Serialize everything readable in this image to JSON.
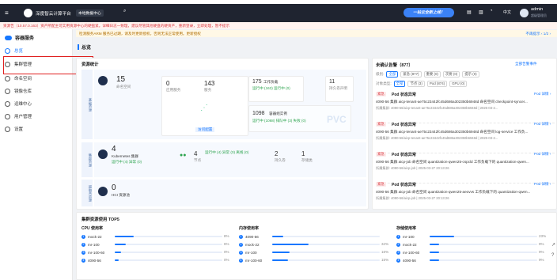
{
  "header": {
    "app_title": "深度智云计算平台",
    "region": "本地数据中心",
    "promo": "一站云全新上线！",
    "lang": "中文",
    "user": "admin",
    "user_sub": "超级管理员"
  },
  "warnings": {
    "line1": "资源告（10.57.0.163）资产所配主可实用资源中心的硬盘紧。详细日志一致理，建议尽管其他硬盘的硬资产，重新登录，立即处理，暂不提示",
    "line2": "检测服务ARM 服务已过期，请及时更新授权，否则无法正常使用。更新授权",
    "pager": "不再提示 ‹ 1/2 ›"
  },
  "sidebar": {
    "title": "容器服务",
    "items": [
      {
        "label": "总览"
      },
      {
        "label": "集群管理"
      },
      {
        "label": "命名空间"
      },
      {
        "label": "镜像仓库"
      },
      {
        "label": "运维中心"
      },
      {
        "label": "用户管理"
      },
      {
        "label": "设置"
      }
    ]
  },
  "page": {
    "title": "总览"
  },
  "resource": {
    "title": "资源统计",
    "namespace_count": "15",
    "namespace_label": "命名空间",
    "apps_count": "0",
    "apps_label": "应用服务",
    "services_count": "143",
    "services_label": "服务",
    "workload_count": "175",
    "workload_label": "工作负载",
    "workload_stats": "运行中 (163)  运行中 (0)",
    "storage_count": "11",
    "storage_label": "持久卷声明",
    "pods_count": "1098",
    "pods_label": "容器组实例",
    "pods_stats": "运行中 (1068)  排队中 (3)  失败 (0)",
    "sub_label": "访问配置",
    "pvc": "PVC",
    "cluster_count": "4",
    "cluster_label": "Kubernetes 集群",
    "cluster_stats": "运行中 (4)  异常 (0)",
    "nodes_count": "4",
    "nodes_label": "节点",
    "nodes_stats": "运行中 (4)  异常 (0)  离线 (0)",
    "gpu_count": "2",
    "gpu_label": "持久卷",
    "storage2_count": "1",
    "storage2_label": "存储类",
    "hci_count": "0",
    "hci_label": "HCI 资源池",
    "side_labels": [
      "基础资源",
      "集群资源",
      "超融合资源"
    ]
  },
  "alerts": {
    "title": "未确认告警（877）",
    "all_link": "全部告警事件",
    "filter1_label": "级别:",
    "filter1": [
      "全部",
      "紧急 (877)",
      "重要 (0)",
      "次要 (0)",
      "提示 (0)"
    ],
    "filter2_label": "对象类型:",
    "filter2": [
      "全部",
      "节点 (3)",
      "Pod (874)",
      "GPU (0)"
    ],
    "items": [
      {
        "level": "紧急",
        "title": "Pod 状态异常",
        "link": "Pod 详情 ›",
        "desc": "4090-56 集群 aicp-tenant-ae75c23442fc45d686a302350b6948d 命名空间 checkpoint-syncer...",
        "meta": "所属集群: 4090-56/aicp-tenant-ae75c23442fc45d686a302350b6948d | 2025-03-2..."
      },
      {
        "level": "紧急",
        "title": "Pod 状态异常",
        "link": "Pod 详情 ›",
        "desc": "4090-56 集群 aicp-tenant-ae75c23442fc45d686a302350b6948d 命名空间 log-service 工作负...",
        "meta": "所属集群: 4090-56/aicp-tenant-ae75c23442fc45d686a302350b6948d | 2025-03-2..."
      },
      {
        "level": "紧急",
        "title": "Pod 状态异常",
        "link": "Pod 详情 ›",
        "desc": "4090-56 集群 aicp-job 命名空间 quantization-qwen25-cspcld 工作负载下的 quantization-qwen...",
        "meta": "所属集群: 4090-56/aicp-job | 2025-03-27 20:13:26"
      },
      {
        "level": "紧急",
        "title": "Pod 状态异常",
        "link": "Pod 详情 ›",
        "desc": "4090-56 集群 aicp-job 命名空间 quantization-qwen25-aeovvs 工作负载下的 quantization-qwen...",
        "meta": "所属集群: 4090-56/aicp-job | 2025-03-27 20:13:26"
      }
    ]
  },
  "top5": {
    "title": "集群资源使用 TOP5",
    "cpu": {
      "title": "CPU 使用率",
      "rows": [
        {
          "rank": "1",
          "name": "mock-22",
          "pct": "8%",
          "v": 0.18
        },
        {
          "rank": "2",
          "name": "mr-100",
          "pct": "6%",
          "v": 0.1
        },
        {
          "rank": "3",
          "name": "mr-100-60",
          "pct": "0%",
          "v": 0.06
        },
        {
          "rank": "4",
          "name": "4090-56",
          "pct": "0%",
          "v": 0.04
        }
      ]
    },
    "mem": {
      "title": "内存使用率",
      "rows": [
        {
          "rank": "1",
          "name": "4090-56",
          "pct": "",
          "v": 0.1
        },
        {
          "rank": "2",
          "name": "mock-22",
          "pct": "34%",
          "v": 0.34
        },
        {
          "rank": "3",
          "name": "mr-100",
          "pct": "16%",
          "v": 0.16
        },
        {
          "rank": "4",
          "name": "mr-100-60",
          "pct": "15%",
          "v": 0.15
        }
      ]
    },
    "disk": {
      "title": "存储使用率",
      "rows": [
        {
          "rank": "1",
          "name": "mr-100",
          "pct": "23%",
          "v": 0.23
        },
        {
          "rank": "2",
          "name": "mock-22",
          "pct": "9%",
          "v": 0.09
        },
        {
          "rank": "3",
          "name": "mr-100-60",
          "pct": "9%",
          "v": 0.09
        },
        {
          "rank": "4",
          "name": "4090-56",
          "pct": "9%",
          "v": 0.09
        }
      ]
    }
  },
  "colors": {
    "accent": "#1677ff",
    "danger": "#d9363e",
    "success": "#2da44e"
  }
}
